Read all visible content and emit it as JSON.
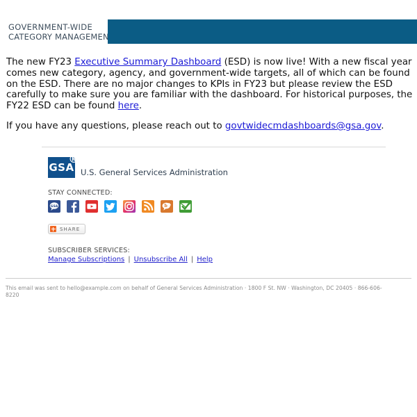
{
  "header": {
    "logo_line1": "GOVERNMENT-WIDE",
    "logo_line2": "CATEGORY MANAGEMENT",
    "banner_color": "#0b5c85"
  },
  "body": {
    "paragraph1": {
      "part1": "The new FY23 ",
      "link1": "Executive Summary Dashboard",
      "part2": " (ESD) is now live! With a new fiscal year comes new category, agency, and government-wide targets, all of which can be found on the ESD.  There are no major changes to KPIs in FY23 but please review the ESD carefully to make sure you are familiar with the dashboard. For historical purposes, the FY22 ESD can be found ",
      "link2": "here",
      "part3": "."
    },
    "paragraph2": {
      "part1": "If you have any questions, please reach out to ",
      "link1": "govtwidecmdashboards@gsa.gov",
      "part2": "."
    }
  },
  "gsa": {
    "mark_text": "GSA",
    "trademark": "®",
    "agency_name": "U.S. General Services Administration",
    "mark_color": "#10508c"
  },
  "stay_connected": {
    "label": "STAY CONNECTED:",
    "icons": [
      {
        "name": "gsa-blog-icon",
        "label": "GSA",
        "color": "#2b4a8b"
      },
      {
        "name": "facebook-icon",
        "label": "Facebook",
        "color": "#3b5998"
      },
      {
        "name": "youtube-icon",
        "label": "YouTube",
        "color": "#e02f2f"
      },
      {
        "name": "twitter-icon",
        "label": "Twitter",
        "color": "#1da1f2"
      },
      {
        "name": "instagram-icon",
        "label": "Instagram",
        "color": "#e1306c"
      },
      {
        "name": "rss-icon",
        "label": "RSS",
        "color": "#f08a23"
      },
      {
        "name": "blog-icon",
        "label": "Blog",
        "color": "#d9792e"
      },
      {
        "name": "email-icon",
        "label": "Email",
        "color": "#3f9c35"
      }
    ]
  },
  "share": {
    "label": "SHARE",
    "aria_label": "Bookmark and Share",
    "plus_color": "#f06724"
  },
  "subscriber_services": {
    "label": "SUBSCRIBER SERVICES:",
    "links": [
      {
        "label": "Manage Subscriptions"
      },
      {
        "label": "Unsubscribe All"
      },
      {
        "label": "Help"
      }
    ],
    "separator": "|"
  },
  "legal": {
    "text": "This email was sent to hello@example.com on behalf of General Services Administration  · 1800 F St. NW · Washington, DC 20405  ·  866-606-8220"
  }
}
